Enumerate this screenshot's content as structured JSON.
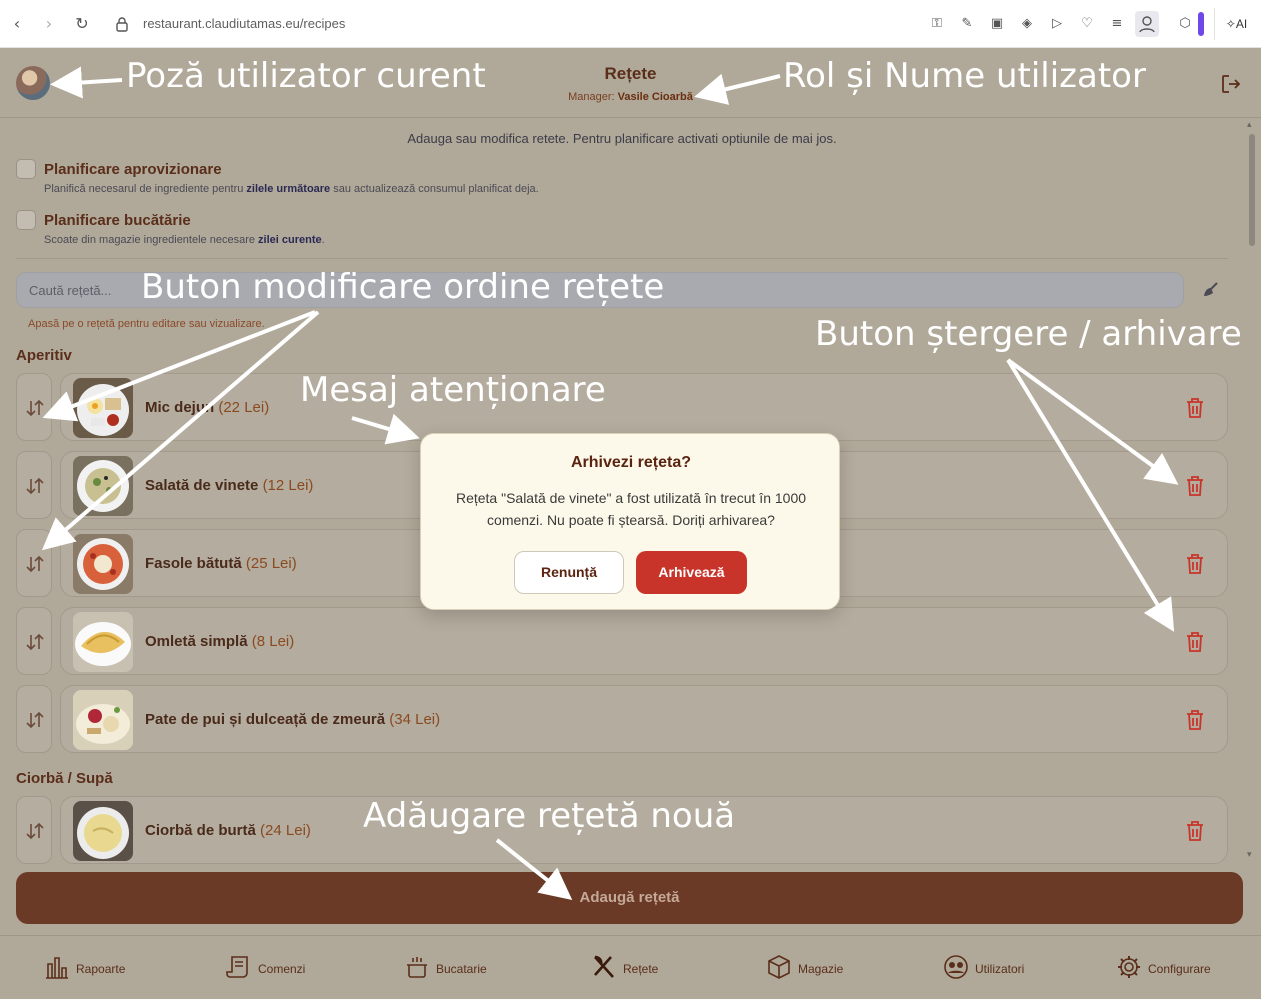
{
  "browser": {
    "url_host": "restaurant.claudiutamas.eu",
    "url_path": "/recipes",
    "ai_label": "AI"
  },
  "header": {
    "title": "Rețete",
    "role_label": "Manager:",
    "user_name": "Vasile Cioarbă"
  },
  "intro": "Adauga sau modifica retete. Pentru planificare activati optiunile de mai jos.",
  "options": [
    {
      "title": "Planificare aprovizionare",
      "desc_pre": "Planifică necesarul de ingrediente pentru ",
      "desc_bold": "zilele următoare",
      "desc_post": " sau actualizează consumul planificat deja.",
      "checked": false
    },
    {
      "title": "Planificare bucătărie",
      "desc_pre": "Scoate din magazie ingredientele necesare ",
      "desc_bold": "zilei curente",
      "desc_post": ".",
      "checked": false
    }
  ],
  "search": {
    "placeholder": "Caută rețetă..."
  },
  "hint": "Apasă pe o rețetă pentru editare sau vizualizare.",
  "sections": [
    {
      "name": "Aperitiv",
      "recipes": [
        {
          "name": "Mic dejun",
          "price": "(22 Lei)"
        },
        {
          "name": "Salată de vinete",
          "price": "(12 Lei)"
        },
        {
          "name": "Fasole bătută",
          "price": "(25 Lei)"
        },
        {
          "name": "Omletă simplă",
          "price": "(8 Lei)"
        },
        {
          "name": "Pate de pui și dulceață de zmeură",
          "price": "(34 Lei)"
        }
      ]
    },
    {
      "name": "Ciorbă / Supă",
      "recipes": [
        {
          "name": "Ciorbă de burtă",
          "price": "(24 Lei)"
        }
      ]
    }
  ],
  "add_button": "Adaugă rețetă",
  "bottom_nav": [
    {
      "label": "Rapoarte",
      "icon": "chart-icon"
    },
    {
      "label": "Comenzi",
      "icon": "orders-icon"
    },
    {
      "label": "Bucatarie",
      "icon": "pot-icon"
    },
    {
      "label": "Rețete",
      "icon": "utensils-icon",
      "active": true
    },
    {
      "label": "Magazie",
      "icon": "box-icon"
    },
    {
      "label": "Utilizatori",
      "icon": "users-icon"
    },
    {
      "label": "Configurare",
      "icon": "gear-icon"
    }
  ],
  "modal": {
    "title": "Arhivezi rețeta?",
    "message": "Rețeta \"Salată de vinete\" a fost utilizată în trecut în 1000 comenzi. Nu poate fi ștearsă. Doriți arhivarea?",
    "cancel_label": "Renunță",
    "confirm_label": "Arhivează",
    "confirm_color": "#c8342a"
  },
  "annotations": {
    "current_user_photo": "Poză utilizator curent",
    "role_and_name": "Rol și Nume utilizator",
    "reorder_button": "Buton modificare ordine rețete",
    "delete_button": "Buton ștergere / arhivare",
    "warning_message": "Mesaj atenționare",
    "add_recipe": "Adăugare rețetă nouă"
  },
  "colors": {
    "background": "#b0a898",
    "accent_brown": "#6b3a26",
    "title_brown": "#5a2e1a",
    "trash_red": "#c8342a",
    "modal_bg": "#fdf9ea"
  }
}
